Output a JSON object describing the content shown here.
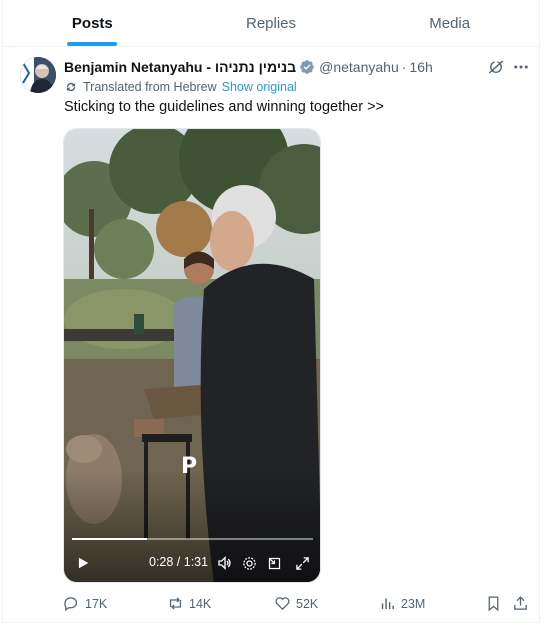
{
  "tabs": [
    {
      "label": "Posts",
      "active": true
    },
    {
      "label": "Replies",
      "active": false
    },
    {
      "label": "Media",
      "active": false
    }
  ],
  "post": {
    "author_name": "Benjamin Netanyahu - בנימין נתניהו",
    "handle": "@netanyahu",
    "separator": "·",
    "time": "16h",
    "translated_label": "Translated from Hebrew",
    "show_original": "Show original",
    "text": "Sticking to the guidelines and winning together >>",
    "verified_icon": "verified-badge-icon",
    "video": {
      "watermark": "P",
      "current_time": "0:28",
      "duration": "1:31",
      "time_display": "0:28 / 1:31",
      "progress_fraction": 0.31
    },
    "actions": {
      "replies": "17K",
      "reposts": "14K",
      "likes": "52K",
      "views": "23M"
    }
  },
  "colors": {
    "accent": "#1d9bf0",
    "text_primary": "#0f1419",
    "text_secondary": "#536471",
    "verified": "#829aab"
  }
}
